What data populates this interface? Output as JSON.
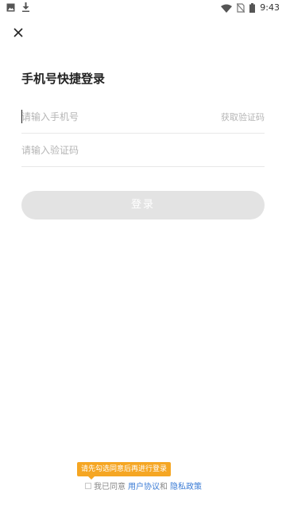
{
  "status_bar": {
    "time": "9:43",
    "left_icons": [
      "image-icon",
      "download-icon"
    ],
    "right_icons": [
      "wifi-icon",
      "no-sim-icon",
      "battery-icon"
    ]
  },
  "header": {
    "close_icon": "close-icon"
  },
  "title": "手机号快捷登录",
  "phone_field": {
    "placeholder": "请输入手机号",
    "value": "",
    "get_code_label": "获取验证码"
  },
  "code_field": {
    "placeholder": "请输入验证码",
    "value": ""
  },
  "login_button": {
    "label": "登录"
  },
  "agreement": {
    "tip": "请先勾选同意后再进行登录",
    "checked": false,
    "prefix": "我已同意",
    "user_agreement": "用户协议",
    "and": "和",
    "privacy_policy": "隐私政策"
  },
  "colors": {
    "tip_background": "#f5a623",
    "link": "#3a7bd5",
    "button_disabled": "#e3e3e3"
  }
}
